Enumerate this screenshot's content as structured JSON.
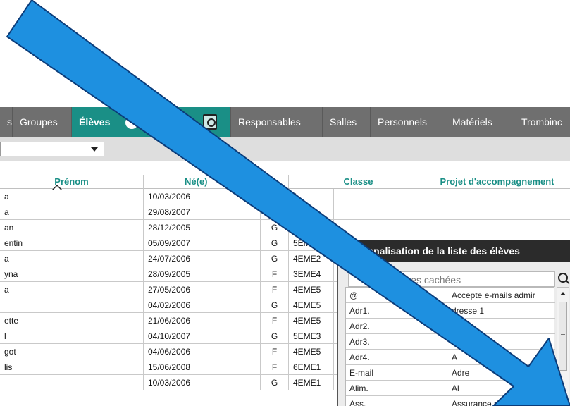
{
  "tabs": [
    {
      "label": "s"
    },
    {
      "label": "Groupes"
    },
    {
      "label": "Élèves"
    },
    {
      "label": "Responsables"
    },
    {
      "label": "Salles"
    },
    {
      "label": "Personnels"
    },
    {
      "label": "Matériels"
    },
    {
      "label": "Trombinc"
    }
  ],
  "filter": {
    "selected": ""
  },
  "table": {
    "headers": {
      "prenom": "Prénom",
      "ne": "Né(e)",
      "classe": "Classe",
      "projet": "Projet d'accompagnement"
    },
    "rows": [
      {
        "prenom": "a",
        "ne": "10/03/2006",
        "sexe": "",
        "classe": "1"
      },
      {
        "prenom": "a",
        "ne": "29/08/2007",
        "sexe": "",
        "classe": ""
      },
      {
        "prenom": "an",
        "ne": "28/12/2005",
        "sexe": "G",
        "classe": ""
      },
      {
        "prenom": "entin",
        "ne": "05/09/2007",
        "sexe": "G",
        "classe": "5EM"
      },
      {
        "prenom": "a",
        "ne": "24/07/2006",
        "sexe": "G",
        "classe": "4EME2"
      },
      {
        "prenom": "yna",
        "ne": "28/09/2005",
        "sexe": "F",
        "classe": "3EME4"
      },
      {
        "prenom": "a",
        "ne": "27/05/2006",
        "sexe": "F",
        "classe": "4EME5"
      },
      {
        "prenom": "",
        "ne": "04/02/2006",
        "sexe": "G",
        "classe": "4EME5"
      },
      {
        "prenom": "ette",
        "ne": "21/06/2006",
        "sexe": "F",
        "classe": "4EME5"
      },
      {
        "prenom": "l",
        "ne": "04/10/2007",
        "sexe": "G",
        "classe": "5EME3"
      },
      {
        "prenom": "got",
        "ne": "04/06/2006",
        "sexe": "F",
        "classe": "4EME5"
      },
      {
        "prenom": "lis",
        "ne": "15/06/2008",
        "sexe": "F",
        "classe": "6EME1"
      },
      {
        "prenom": "",
        "ne": "10/03/2006",
        "sexe": "G",
        "classe": "4EME1"
      }
    ]
  },
  "panel": {
    "title": "ersonnalisation de la liste des élèves",
    "hidden_label": "olonnes cachées",
    "items": [
      {
        "abbr": "@",
        "label": "Accepte e-mails admir"
      },
      {
        "abbr": "Adr1.",
        "label": "dresse 1"
      },
      {
        "abbr": "Adr2.",
        "label": "e 2"
      },
      {
        "abbr": "Adr3.",
        "label": ""
      },
      {
        "abbr": "Adr4.",
        "label": "A"
      },
      {
        "abbr": "E-mail",
        "label": "Adre"
      },
      {
        "abbr": "Alim.",
        "label": "Al"
      },
      {
        "abbr": "Ass.",
        "label": "Assurance responsab"
      }
    ]
  },
  "colors": {
    "tab_bar": "#6f6f6f",
    "active_tab": "#1a8f86",
    "header_text": "#1a8f86",
    "panel_title": "#2b2b2b",
    "arrow_fill": "#1e90e0",
    "arrow_stroke": "#0b3c7a"
  },
  "icons": [
    "search-icon",
    "chevron-down-icon",
    "sort-ascending-icon",
    "document-search-icon",
    "scroll-up-icon",
    "arrow-annotation"
  ]
}
